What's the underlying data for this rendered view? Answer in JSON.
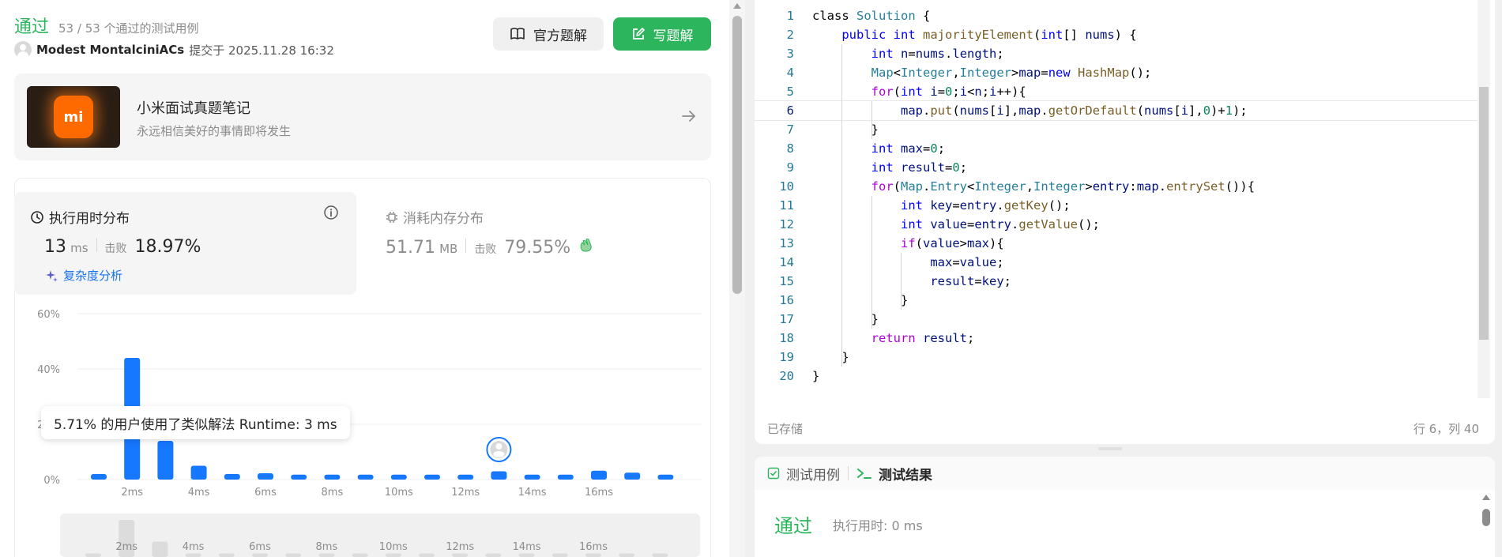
{
  "submission": {
    "status": "通过",
    "count": "53 / 53 个通过的测试用例",
    "user": "Modest MontalciniACs",
    "submitted": "提交于 2025.11.28 16:32"
  },
  "header_buttons": {
    "official": "官方题解",
    "write": "写题解"
  },
  "note_card": {
    "logo_text": "mi",
    "title": "小米面试真题笔记",
    "subtitle": "永远相信美好的事情即将发生"
  },
  "runtime": {
    "title": "执行用时分布",
    "value": "13",
    "unit": "ms",
    "beat_label": "击败",
    "beat_pct": "18.97%",
    "complexity_link": "复杂度分析"
  },
  "memory": {
    "title": "消耗内存分布",
    "value": "51.71",
    "unit": "MB",
    "beat_label": "击败",
    "beat_pct": "79.55%"
  },
  "tooltip": "5.71% 的用户使用了类似解法 Runtime: 3 ms",
  "chart_data": {
    "type": "bar",
    "x": [
      1,
      2,
      3,
      4,
      5,
      6,
      7,
      8,
      9,
      10,
      11,
      12,
      13,
      14,
      15,
      16,
      17,
      18
    ],
    "values": [
      2,
      44,
      14,
      5,
      2,
      2.3,
      1.8,
      1.8,
      1.8,
      1.8,
      1.8,
      1.8,
      3,
      1.8,
      1.8,
      3.2,
      2.5,
      1.8
    ],
    "ylim": [
      0,
      60
    ],
    "yticks": [
      "60%",
      "40%",
      "20%",
      "0%"
    ],
    "xticks": [
      "2ms",
      "4ms",
      "6ms",
      "8ms",
      "10ms",
      "12ms",
      "14ms",
      "16ms"
    ],
    "highlight_index": 12,
    "colors": {
      "bar": "#1677ff",
      "grid": "#ededed",
      "axis_text": "#8c8c8c"
    }
  },
  "mini_chart": {
    "values": [
      1,
      18,
      7,
      1,
      1,
      1,
      1,
      1,
      1,
      1,
      1,
      1,
      1,
      1,
      1,
      1,
      1,
      1
    ],
    "xticks": [
      "2ms",
      "4ms",
      "6ms",
      "8ms",
      "10ms",
      "12ms",
      "14ms",
      "16ms"
    ]
  },
  "code": [
    [
      [
        "",
        "class "
      ],
      [
        "t",
        "Solution"
      ],
      [
        "",
        " {"
      ]
    ],
    [
      [
        "",
        "    "
      ],
      [
        "k",
        "public"
      ],
      [
        "",
        " "
      ],
      [
        "k",
        "int"
      ],
      [
        "",
        " "
      ],
      [
        "f",
        "majorityElement"
      ],
      [
        "",
        "("
      ],
      [
        "k",
        "int"
      ],
      [
        "",
        "[] "
      ],
      [
        "v",
        "nums"
      ],
      [
        "",
        ") {"
      ]
    ],
    [
      [
        "",
        "        "
      ],
      [
        "k",
        "int"
      ],
      [
        "",
        " "
      ],
      [
        "v",
        "n"
      ],
      [
        "",
        "="
      ],
      [
        "v",
        "nums"
      ],
      [
        "",
        "."
      ],
      [
        "v",
        "length"
      ],
      [
        "",
        ";"
      ]
    ],
    [
      [
        "",
        "        "
      ],
      [
        "t",
        "Map"
      ],
      [
        "",
        "<"
      ],
      [
        "t",
        "Integer"
      ],
      [
        "",
        ","
      ],
      [
        "t",
        "Integer"
      ],
      [
        "",
        ">"
      ],
      [
        "v",
        "map"
      ],
      [
        "",
        "="
      ],
      [
        "k",
        "new"
      ],
      [
        "",
        " "
      ],
      [
        "f",
        "HashMap"
      ],
      [
        "",
        "();"
      ]
    ],
    [
      [
        "",
        "        "
      ],
      [
        "kc",
        "for"
      ],
      [
        "",
        "("
      ],
      [
        "k",
        "int"
      ],
      [
        "",
        " "
      ],
      [
        "v",
        "i"
      ],
      [
        "",
        "="
      ],
      [
        "n",
        "0"
      ],
      [
        "",
        ";"
      ],
      [
        "v",
        "i"
      ],
      [
        "",
        "<"
      ],
      [
        "v",
        "n"
      ],
      [
        "",
        ";"
      ],
      [
        "v",
        "i"
      ],
      [
        "",
        "++){"
      ]
    ],
    [
      [
        "",
        "            "
      ],
      [
        "v",
        "map"
      ],
      [
        "",
        "."
      ],
      [
        "f",
        "put"
      ],
      [
        "",
        "("
      ],
      [
        "v",
        "nums"
      ],
      [
        "",
        "["
      ],
      [
        "v",
        "i"
      ],
      [
        "",
        "],"
      ],
      [
        "v",
        "map"
      ],
      [
        "",
        "."
      ],
      [
        "f",
        "getOrDefault"
      ],
      [
        "",
        "("
      ],
      [
        "v",
        "nums"
      ],
      [
        "",
        "["
      ],
      [
        "v",
        "i"
      ],
      [
        "",
        "],"
      ],
      [
        "n",
        "0"
      ],
      [
        "",
        ")+"
      ],
      [
        "n",
        "1"
      ],
      [
        "",
        ");"
      ]
    ],
    [
      [
        "",
        "        }"
      ]
    ],
    [
      [
        "",
        "        "
      ],
      [
        "k",
        "int"
      ],
      [
        "",
        " "
      ],
      [
        "v",
        "max"
      ],
      [
        "",
        "="
      ],
      [
        "n",
        "0"
      ],
      [
        "",
        ";"
      ]
    ],
    [
      [
        "",
        "        "
      ],
      [
        "k",
        "int"
      ],
      [
        "",
        " "
      ],
      [
        "v",
        "result"
      ],
      [
        "",
        "="
      ],
      [
        "n",
        "0"
      ],
      [
        "",
        ";"
      ]
    ],
    [
      [
        "",
        "        "
      ],
      [
        "kc",
        "for"
      ],
      [
        "",
        "("
      ],
      [
        "t",
        "Map"
      ],
      [
        "",
        "."
      ],
      [
        "t",
        "Entry"
      ],
      [
        "",
        "<"
      ],
      [
        "t",
        "Integer"
      ],
      [
        "",
        ","
      ],
      [
        "t",
        "Integer"
      ],
      [
        "",
        ">"
      ],
      [
        "v",
        "entry"
      ],
      [
        "",
        ":"
      ],
      [
        "v",
        "map"
      ],
      [
        "",
        "."
      ],
      [
        "f",
        "entrySet"
      ],
      [
        "",
        "()){"
      ]
    ],
    [
      [
        "",
        "            "
      ],
      [
        "k",
        "int"
      ],
      [
        "",
        " "
      ],
      [
        "v",
        "key"
      ],
      [
        "",
        "="
      ],
      [
        "v",
        "entry"
      ],
      [
        "",
        "."
      ],
      [
        "f",
        "getKey"
      ],
      [
        "",
        "();"
      ]
    ],
    [
      [
        "",
        "            "
      ],
      [
        "k",
        "int"
      ],
      [
        "",
        " "
      ],
      [
        "v",
        "value"
      ],
      [
        "",
        "="
      ],
      [
        "v",
        "entry"
      ],
      [
        "",
        "."
      ],
      [
        "f",
        "getValue"
      ],
      [
        "",
        "();"
      ]
    ],
    [
      [
        "",
        "            "
      ],
      [
        "kc",
        "if"
      ],
      [
        "",
        "("
      ],
      [
        "v",
        "value"
      ],
      [
        "",
        ">"
      ],
      [
        "v",
        "max"
      ],
      [
        "",
        "){"
      ]
    ],
    [
      [
        "",
        "                "
      ],
      [
        "v",
        "max"
      ],
      [
        "",
        "="
      ],
      [
        "v",
        "value"
      ],
      [
        "",
        ";"
      ]
    ],
    [
      [
        "",
        "                "
      ],
      [
        "v",
        "result"
      ],
      [
        "",
        "="
      ],
      [
        "v",
        "key"
      ],
      [
        "",
        ";"
      ]
    ],
    [
      [
        "",
        "            }"
      ]
    ],
    [
      [
        "",
        "        }"
      ]
    ],
    [
      [
        "",
        "        "
      ],
      [
        "kc",
        "return"
      ],
      [
        "",
        " "
      ],
      [
        "v",
        "result"
      ],
      [
        "",
        ";"
      ]
    ],
    [
      [
        "",
        "    }"
      ]
    ],
    [
      [
        "",
        "}"
      ]
    ]
  ],
  "active_line": 6,
  "editor_footer": {
    "saved": "已存储",
    "position": "行 6，列 40"
  },
  "result_tabs": {
    "testcase": "测试用例",
    "result": "测试结果"
  },
  "result": {
    "status": "通过",
    "time": "执行用时: 0 ms"
  }
}
